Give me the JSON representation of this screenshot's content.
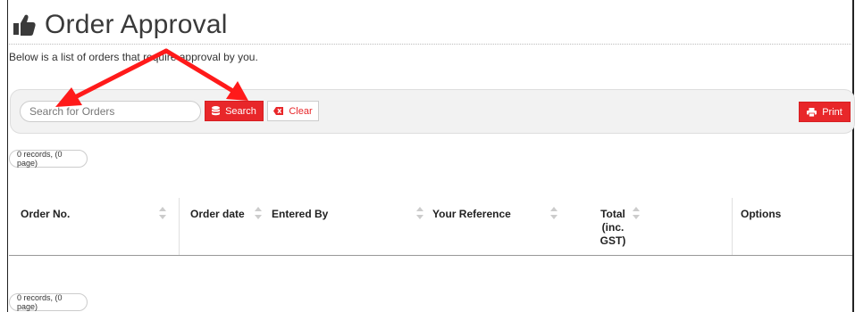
{
  "page": {
    "title": "Order Approval",
    "description": "Below is a list of orders that require approval by you."
  },
  "toolbar": {
    "search_placeholder": "Search for Orders",
    "search_value": "",
    "search_label": "Search",
    "clear_label": "Clear",
    "print_label": "Print"
  },
  "records_top": "0 records, (0 page)",
  "records_bottom": "0 records, (0 page)",
  "table": {
    "columns": [
      {
        "label": "Order No."
      },
      {
        "label": "Order date"
      },
      {
        "label": "Entered By"
      },
      {
        "label": "Your Reference"
      },
      {
        "label": "Total (inc. GST)"
      },
      {
        "label": "Options"
      }
    ],
    "rows": []
  },
  "colors": {
    "accent": "#e8272a",
    "annotation_arrow": "#ff1a1a"
  },
  "icons": {
    "title": "thumbs-up-icon",
    "search": "database-icon",
    "clear": "backspace-icon",
    "print": "printer-icon"
  }
}
